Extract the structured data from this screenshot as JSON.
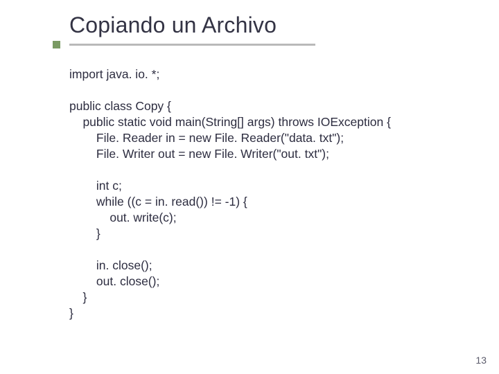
{
  "title": "Copiando un Archivo",
  "page_number": "13",
  "code": {
    "l01": "import java. io. *;",
    "l02": "",
    "l03": "public class Copy {",
    "l04": "    public static void main(String[] args) throws IOException {",
    "l05": "        File. Reader in = new File. Reader(\"data. txt\");",
    "l06": "        File. Writer out = new File. Writer(\"out. txt\");",
    "l07": "",
    "l08": "        int c;",
    "l09": "        while ((c = in. read()) != -1) {",
    "l10": "            out. write(c);",
    "l11": "        }",
    "l12": "",
    "l13": "        in. close();",
    "l14": "        out. close();",
    "l15": "    }",
    "l16": "}"
  }
}
